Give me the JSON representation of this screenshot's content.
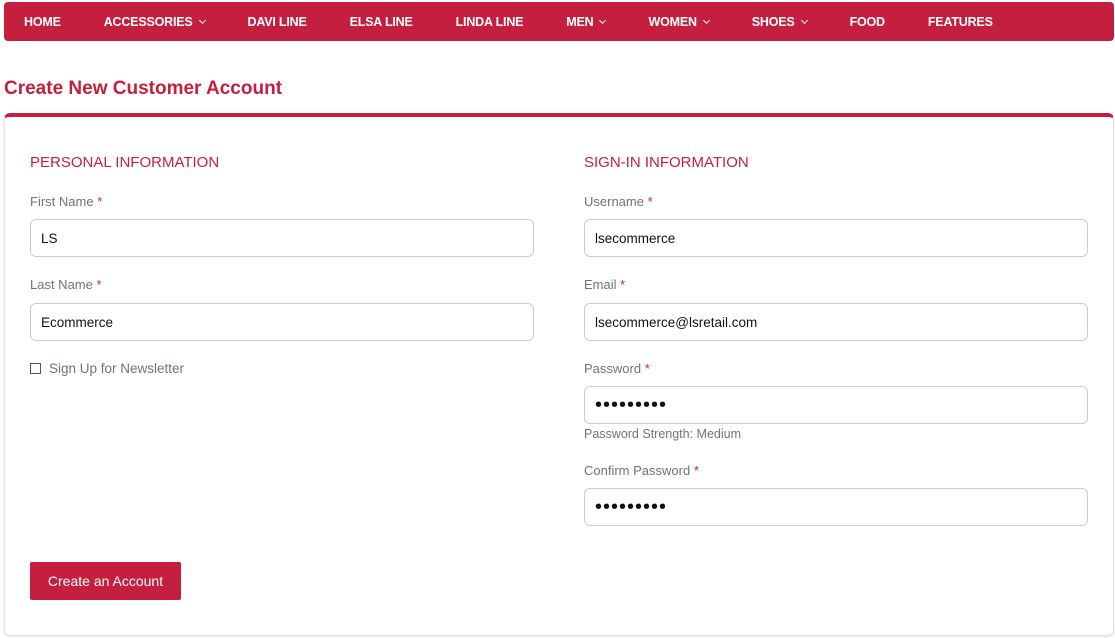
{
  "nav": {
    "items": [
      {
        "label": "HOME",
        "dropdown": false
      },
      {
        "label": "ACCESSORIES",
        "dropdown": true
      },
      {
        "label": "DAVI LINE",
        "dropdown": false
      },
      {
        "label": "ELSA LINE",
        "dropdown": false
      },
      {
        "label": "LINDA LINE",
        "dropdown": false
      },
      {
        "label": "MEN",
        "dropdown": true
      },
      {
        "label": "WOMEN",
        "dropdown": true
      },
      {
        "label": "SHOES",
        "dropdown": true
      },
      {
        "label": "FOOD",
        "dropdown": false
      },
      {
        "label": "FEATURES",
        "dropdown": false
      }
    ]
  },
  "page": {
    "title": "Create New Customer Account"
  },
  "personal": {
    "heading": "PERSONAL INFORMATION",
    "first_name_label": "First Name",
    "first_name": "LS",
    "last_name_label": "Last Name",
    "last_name": "Ecommerce",
    "newsletter_label": "Sign Up for Newsletter",
    "required_mark": "*"
  },
  "signin": {
    "heading": "SIGN-IN INFORMATION",
    "username_label": "Username",
    "username": "lsecommerce",
    "email_label": "Email",
    "email": "lsecommerce@lsretail.com",
    "password_label": "Password",
    "password": "•••••••••",
    "strength": "Password Strength: Medium",
    "confirm_label": "Confirm Password",
    "confirm": "•••••••••"
  },
  "submit_label": "Create an Account",
  "colors": {
    "brand": "#c41f3e"
  }
}
